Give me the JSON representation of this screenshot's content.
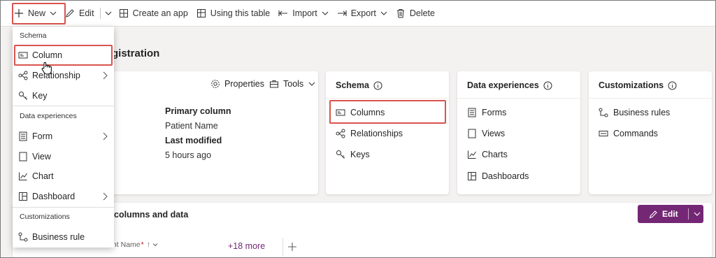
{
  "toolbar": {
    "new_label": "New",
    "edit_label": "Edit",
    "create_app_label": "Create an app",
    "using_table_label": "Using this table",
    "import_label": "Import",
    "export_label": "Export",
    "delete_label": "Delete"
  },
  "new_menu": {
    "section_schema": "Schema",
    "column": "Column",
    "relationship": "Relationship",
    "key": "Key",
    "section_data_experiences": "Data experiences",
    "form": "Form",
    "view": "View",
    "chart": "Chart",
    "dashboard": "Dashboard",
    "section_customizations": "Customizations",
    "business_rule": "Business rule"
  },
  "page": {
    "title_partial": "gistration"
  },
  "table_card": {
    "properties_label": "Properties",
    "tools_label": "Tools",
    "primary_column_label": "Primary column",
    "primary_column_value": "Patient Name",
    "last_modified_label": "Last modified",
    "last_modified_value": "5 hours ago"
  },
  "schema_card": {
    "title": "Schema",
    "columns": "Columns",
    "relationships": "Relationships",
    "keys": "Keys"
  },
  "data_experiences_card": {
    "title": "Data experiences",
    "forms": "Forms",
    "views": "Views",
    "charts": "Charts",
    "dashboards": "Dashboards"
  },
  "customizations_card": {
    "title": "Customizations",
    "business_rules": "Business rules",
    "commands": "Commands"
  },
  "columns_panel": {
    "title_partial": "columns and data",
    "edit_label": "Edit",
    "column_header": "Patient Name",
    "required_mark": "*",
    "more_columns": "+18 more"
  },
  "colors": {
    "accent": "#742774",
    "highlight_box": "#d9534f",
    "required": "#c50f1f"
  }
}
